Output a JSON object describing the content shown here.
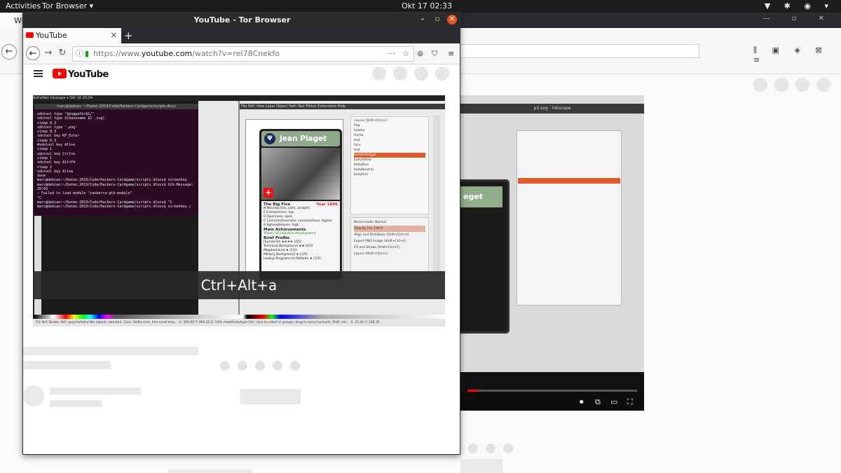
{
  "system": {
    "activities": "Activities",
    "app_menu": "Tor Browser ▾",
    "clock": "Okt 17  02:33",
    "tray": "▼ ✱ ◉ ▾"
  },
  "background_browser": {
    "tab_label": "Wi",
    "window_controls": "— ▫ ✕",
    "back_icon": "←",
    "tools": "⫼ ▣ ◈ ⊠ ≡"
  },
  "window": {
    "title": "YouTube - Tor Browser",
    "minimize": "–",
    "maximize": "▫",
    "close": "✕"
  },
  "tab": {
    "label": "YouTube",
    "close": "✕",
    "new_tab": "+"
  },
  "navbar": {
    "back": "←",
    "forward": "→",
    "reload": "↻",
    "info_icon": "ⓘ",
    "lock_icon": "🔒",
    "url_prefix": "https://www.",
    "url_domain": "youtube.com",
    "url_suffix": "/watch?v=rel78Cnekfo",
    "dots": "···",
    "star": "☆",
    "onion": "⊛",
    "shield": "⛉",
    "menu": "≡"
  },
  "youtube": {
    "logo": "YouTube"
  },
  "video": {
    "topbar": "Activities   Inkscape ▾                                                       Okt 16  20:04",
    "terminal_title": "marc@debian: ~/Daten.2019/Code/Hackers-Cardgame/scripts.dlocs",
    "terminal_lines": [
      "xdotool type \"$pngpath/$1/\"",
      "xdotool type $(basename $1 .svg)",
      "sleep 0.3",
      "xdotool type '.png'",
      "sleep 0.3",
      "xdotool key KP_Enter",
      "sleep 0.3",
      "#xdotool key Alt+e",
      "sleep 1",
      "xdotool key Ctrl+w",
      "sleep 1",
      "xdotool key Alt+F4",
      "sleep 2",
      "xdotool key Alt+w",
      "done",
      "",
      "marc@debian:~/Daten.2019/Code/Hackers-Cardgame/scripts.dlocs$ screenkey",
      "marc@debian:~/Daten.2019/Code/Hackers-Cardgame/scripts.dlocs$ Gtk-Message: 20:03",
      ": Failed to load module \"canberra-gtk-module\"",
      "^C",
      "marc@debian:~/Daten.2019/Code/Hackers-Cardgame/scripts.dlocs$ ^C",
      "marc@debian:~/Daten.2019/Code/Hackers-Cardgame/scripts.dlocs$ screenkey ▯"
    ],
    "inkscape_title": "p3.svg - Inkscape",
    "inkscape_menu": "File  Edit  View  Layer  Object  Path  Text  Filters  Extensions  Help",
    "card_name": "Jean Piaget",
    "card_logo": "Ψ",
    "card_flag": "+",
    "card_section": "The Big Five",
    "card_year_label": "Year",
    "card_year": "1896",
    "card_traits": [
      "N Neuroticism:        calm, analytic",
      "E Extraversion:       low",
      "O Openness:           open",
      "C Conscientiousness:  conscientious, logical",
      "A Agreeableness:      high"
    ],
    "card_main": "Main Achievements",
    "card_main_value": "Theory of cognitive development",
    "card_brief": "Brief Profile",
    "card_brief_rows": [
      "Humanism              ★★★★   (4/5)",
      "Technical Background   ★★     (2/5)",
      "Megalomania            ★      (1/5)",
      "Military Background    ★      (1/5)",
      "Lookup Programs to Patients ★ (1/5)"
    ],
    "layers_title": "Layers (Shift+Ctrl+L)",
    "layers": [
      "flag",
      "header",
      "frame",
      "stat",
      "face",
      "text",
      "textArchetype",
      "bodyYellow",
      "bodyBlue",
      "bodyNeutral",
      "bodyRed"
    ],
    "layers_selected": "textArchetype",
    "blend_mode": "Blend mode:   Normal",
    "opacity": "Opacity (%)                     100.0",
    "dialogs": [
      "Align and Distribute (Shift+Ctrl+A)",
      "Export PNG Image (Shift+Ctrl+E)",
      "Fill and Stroke (Shift+Ctrl+F)",
      "Layers (Shift+Ctrl+L)"
    ],
    "caption": "Ctrl+Alt+a",
    "status_left": "Fill:  N/A    Stroke: N/A     •psychoAstrol    No objects selected. Click, Shift+click, Alt+scroll mou...   X: 395.90  Y: 366.22   Z: 53%",
    "status_right": "•textArchetype   Ctrl: click to select in groups; drag to move hor/vert; Shift: clic...   X: 15.41  Y: 120.36"
  },
  "colors": {
    "accent": "#e95420",
    "youtube_red": "#ff0000",
    "terminal_bg": "#2c0a25",
    "card_green": "#8fa98b",
    "layer_selected": "#e35a2a"
  }
}
